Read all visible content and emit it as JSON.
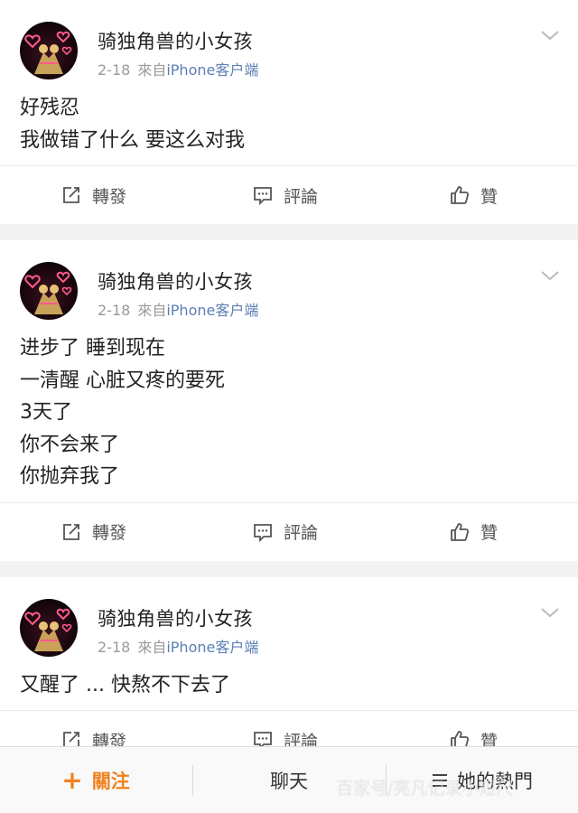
{
  "posts": [
    {
      "username": "骑独角兽的小女孩",
      "date": "2-18",
      "via": "來自",
      "source": "iPhone客户端",
      "lines": [
        "好残忍",
        "我做错了什么 要这么对我"
      ],
      "actions": {
        "repost": "轉發",
        "comment": "評論",
        "like": "贊"
      }
    },
    {
      "username": "骑独角兽的小女孩",
      "date": "2-18",
      "via": "來自",
      "source": "iPhone客户端",
      "lines": [
        "进步了 睡到现在",
        "一清醒 心脏又疼的要死",
        "3天了",
        "你不会来了",
        "你抛弃我了"
      ],
      "actions": {
        "repost": "轉發",
        "comment": "評論",
        "like": "贊"
      }
    },
    {
      "username": "骑独角兽的小女孩",
      "date": "2-18",
      "via": "來自",
      "source": "iPhone客户端",
      "lines": [
        "又醒了 ... 快熬不下去了"
      ],
      "actions": {
        "repost": "轉發",
        "comment": "評論",
        "like": "贊"
      }
    }
  ],
  "bottom_bar": {
    "follow_plus": "+",
    "follow_label": "關注",
    "chat_label": "聊天",
    "hot_label": "她的熱門"
  },
  "watermark": "百家号/亮凡记录小短尺",
  "colors": {
    "accent_orange": "#f0821e",
    "link_blue": "#5b7fb4",
    "meta_gray": "#9a9a9a",
    "background": "#f2f2f2"
  },
  "icons": {
    "avatar": "avatar-hearts-icon",
    "chevron": "chevron-down-icon",
    "repost": "repost-icon",
    "comment": "comment-icon",
    "like": "thumbs-up-icon",
    "menu": "menu-icon"
  }
}
